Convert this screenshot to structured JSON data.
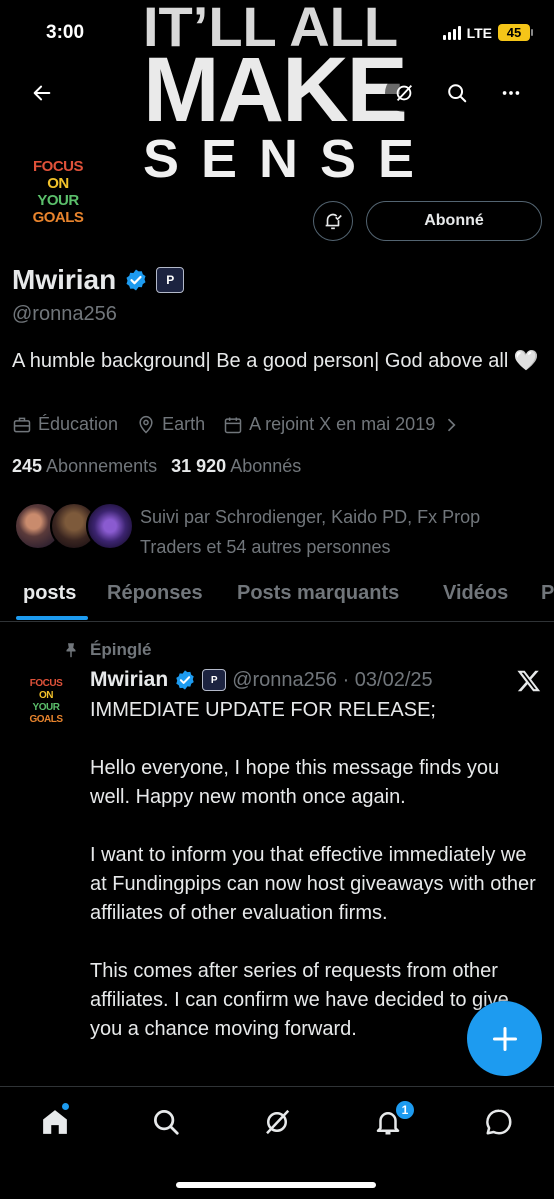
{
  "status_bar": {
    "time": "3:00",
    "network": "LTE",
    "battery": "45"
  },
  "banner": {
    "line1": "IT’LL ALL",
    "line2": "MAKE",
    "line3": "SENSE"
  },
  "avatar": {
    "line1": "FOCUS",
    "line2": "ON",
    "line3": "YOUR",
    "line4": "GOALS"
  },
  "profile": {
    "name": "Mwirian",
    "handle": "@ronna256",
    "affiliate_badge": "P",
    "bio": "A humble background| Be a good person| God above all 🤍",
    "category": "Éducation",
    "location": "Earth",
    "joined": "A rejoint X en mai 2019",
    "following_count": "245",
    "following_label": "Abonnements",
    "followers_count": "31 920",
    "followers_label": "Abonnés",
    "followed_by": "Suivi par Schrodienger, Kaido PD, Fx Prop Traders et 54 autres personnes",
    "follow_button": "Abonné"
  },
  "tabs": [
    "posts",
    "Réponses",
    "Posts marquants",
    "Vidéos",
    "P"
  ],
  "pinned_post": {
    "pinned_label": "Épinglé",
    "author": "Mwirian",
    "handle_date": "@ronna256 · 03/02/25",
    "paragraphs": [
      "IMMEDIATE UPDATE FOR RELEASE;",
      "Hello everyone, I hope this message finds you well. Happy new month once again.",
      "I want to inform you that effective immediately we at Fundingpips can now host giveaways with other affiliates of other evaluation firms.",
      "This comes after series of requests from other affiliates. I can confirm we have decided to give you a chance moving forward."
    ]
  },
  "bottom_nav": {
    "notifications_badge": "1"
  },
  "colors": {
    "accent": "#1d9bf0",
    "background": "#000000",
    "muted": "#71767b",
    "text": "#e7e9ea"
  }
}
